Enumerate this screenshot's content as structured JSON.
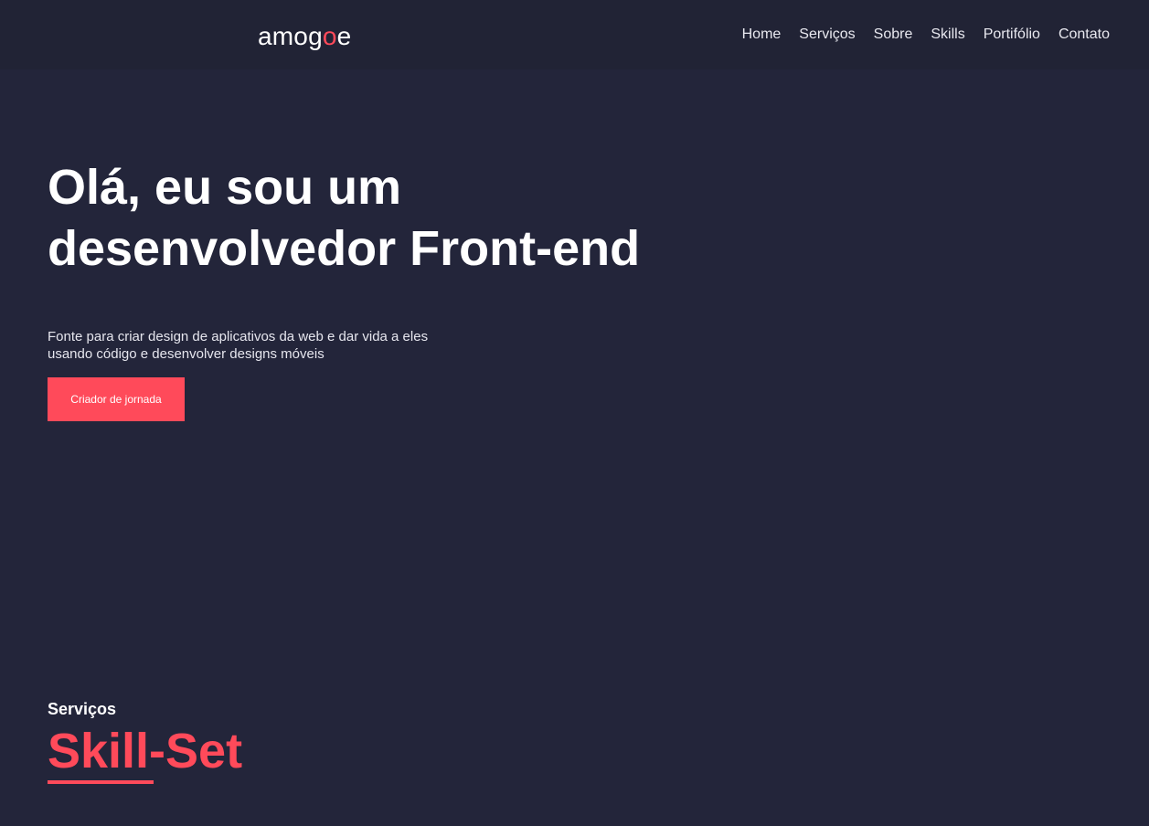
{
  "header": {
    "logo_part1": "amog",
    "logo_accent": "o",
    "logo_part2": "e",
    "nav": [
      {
        "label": "Home"
      },
      {
        "label": "Serviços"
      },
      {
        "label": "Sobre"
      },
      {
        "label": "Skills"
      },
      {
        "label": "Portifólio"
      },
      {
        "label": "Contato"
      }
    ]
  },
  "hero": {
    "title_line1": "Olá, eu sou um",
    "title_line2": "desenvolvedor Front-end",
    "subtitle": "Fonte para criar design de aplicativos da web e dar vida a eles usando código e desenvolver designs móveis",
    "cta_label": "Criador de jornada"
  },
  "services": {
    "label": "Serviços",
    "title": "Skill-Set"
  },
  "colors": {
    "background": "#23253a",
    "accent": "#ff4a5a",
    "text": "#ffffff"
  }
}
